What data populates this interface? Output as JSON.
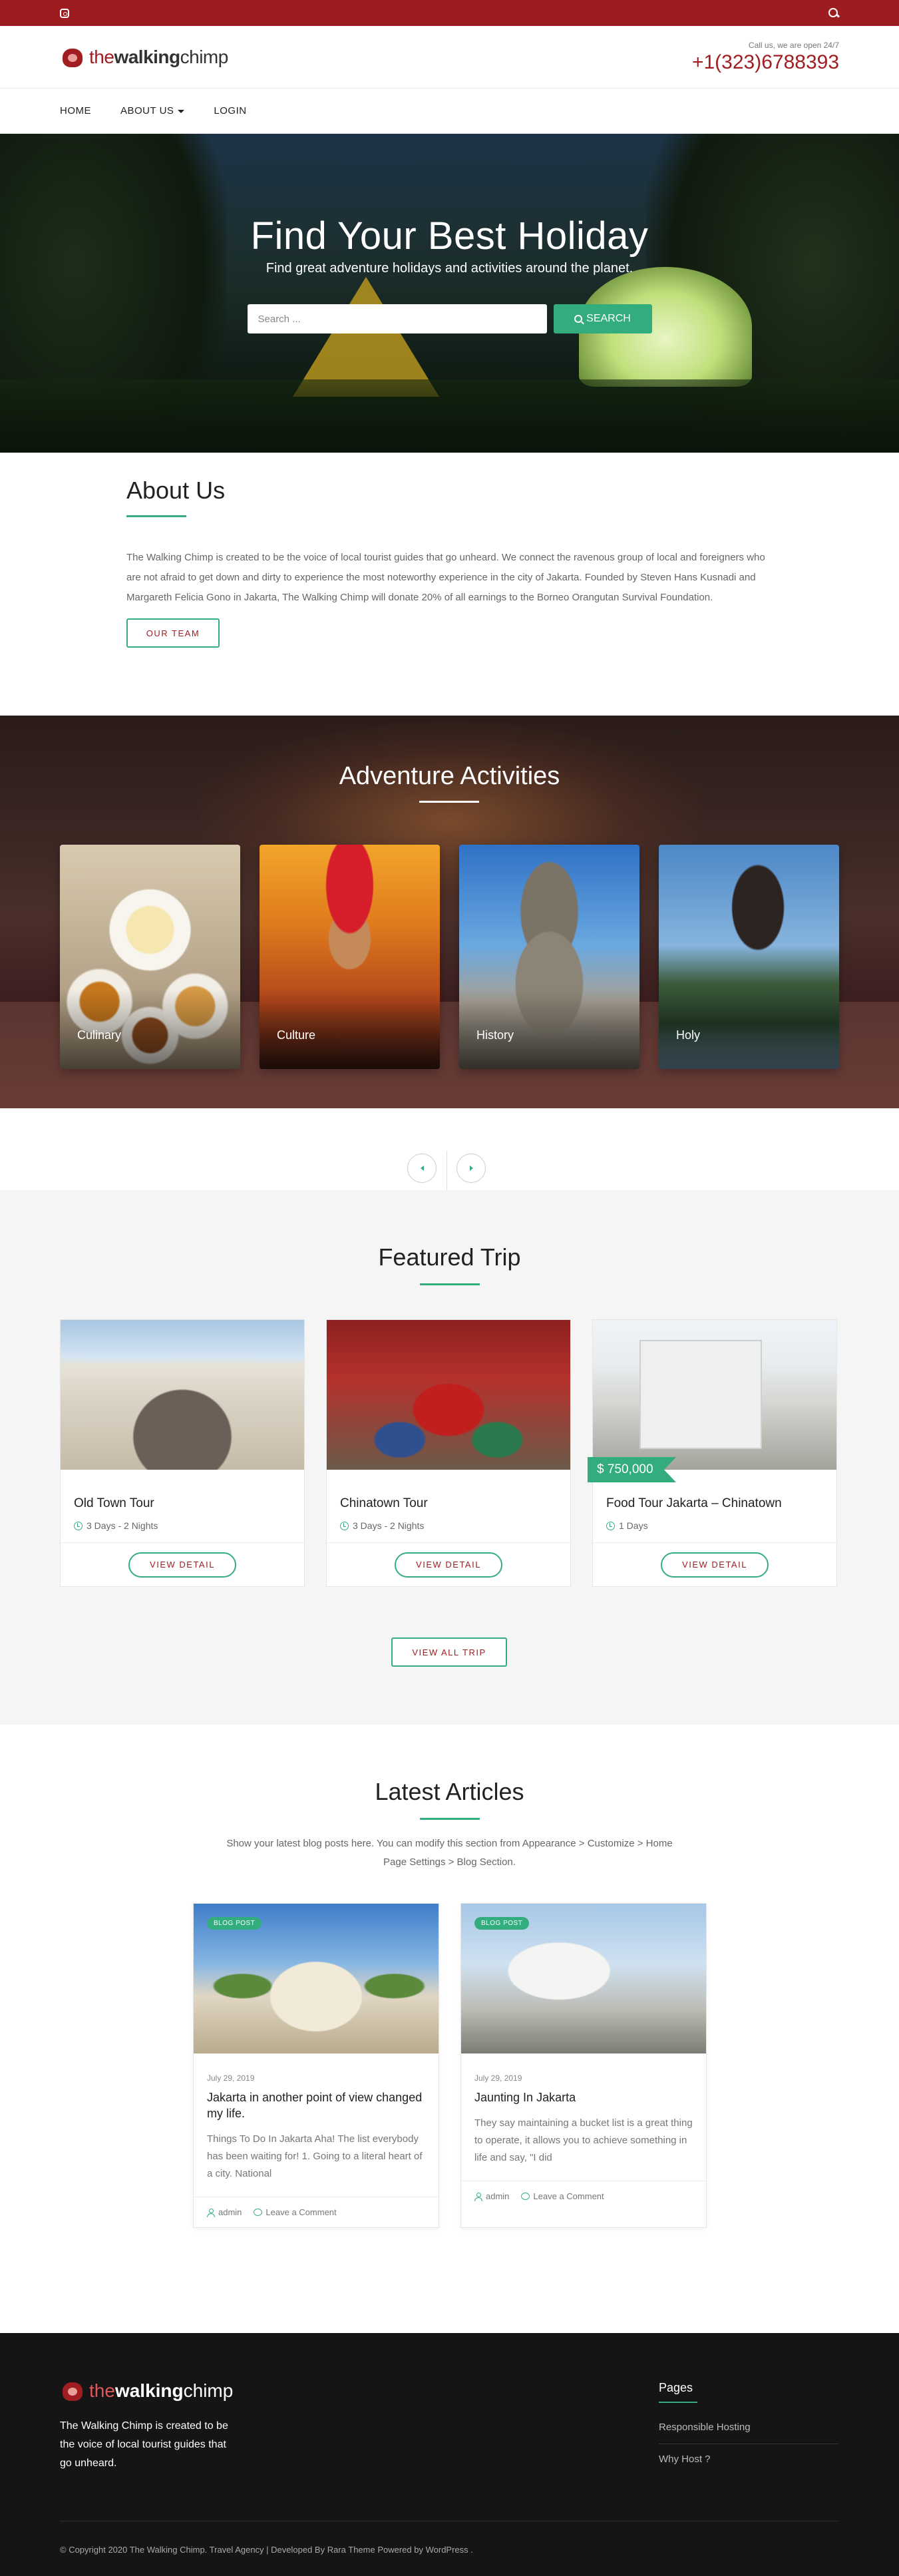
{
  "topbar": {
    "instagram_icon": "instagram-icon",
    "search_icon": "search-icon",
    "bg_color": "#9c1c20"
  },
  "brand": {
    "logo_part1": "the",
    "logo_part2": "walking",
    "logo_part3": "chimp",
    "call_text": "Call us, we are open 24/7",
    "phone": "+1(323)6788393"
  },
  "nav": {
    "items": [
      "HOME",
      "ABOUT US",
      "LOGIN"
    ]
  },
  "hero": {
    "title": "Find Your Best Holiday",
    "subtitle": "Find great adventure holidays and activities around the planet.",
    "search_placeholder": "Search ...",
    "search_button": "SEARCH"
  },
  "about": {
    "title": "About Us",
    "text": "The Walking Chimp is created to be the voice of local tourist guides that go unheard. We connect the ravenous group of local and foreigners who are not afraid to get down and dirty to experience the most noteworthy experience in the city of Jakarta. Founded by Steven Hans Kusnadi and Margareth Felicia Gono in Jakarta, The Walking Chimp will donate 20% of all earnings to the Borneo Orangutan Survival Foundation.",
    "button": "OUR TEAM"
  },
  "activities": {
    "title": "Adventure Activities",
    "items": [
      "Culinary",
      "Culture",
      "History",
      "Holy"
    ]
  },
  "trips": {
    "title": "Featured Trip",
    "items": [
      {
        "title": "Old Town Tour",
        "duration": "3 Days - 2 Nights",
        "button": "VIEW DETAIL",
        "price": ""
      },
      {
        "title": "Chinatown Tour",
        "duration": "3 Days - 2 Nights",
        "button": "VIEW DETAIL",
        "price": ""
      },
      {
        "title": "Food Tour Jakarta – Chinatown",
        "duration": "1 Days",
        "button": "VIEW DETAIL",
        "price": "$ 750,000"
      }
    ],
    "view_all": "VIEW ALL TRIP"
  },
  "articles": {
    "title": "Latest Articles",
    "intro": "Show your latest blog posts here. You can modify this section from Appearance > Customize > Home Page Settings > Blog Section.",
    "items": [
      {
        "badge": "BLOG POST",
        "date": "July 29, 2019",
        "title": "Jakarta in another point of view changed my life.",
        "excerpt": "Things To Do In Jakarta Aha! The list everybody has been waiting for! 1. Going to a literal heart of a city. National",
        "author": "admin",
        "comment": "Leave a Comment"
      },
      {
        "badge": "BLOG POST",
        "date": "July 29, 2019",
        "title": "Jaunting In Jakarta",
        "excerpt": "They say maintaining a bucket list is a great thing to operate, it allows you to achieve something in life and say, \"I did",
        "author": "admin",
        "comment": "Leave a Comment"
      }
    ]
  },
  "footer": {
    "logo_part1": "the",
    "logo_part2": "walking",
    "logo_part3": "chimp",
    "description": "The Walking Chimp is created to be the voice of local tourist guides that go unheard.",
    "pages_title": "Pages",
    "pages_links": [
      "Responsible Hosting",
      "Why Host ?"
    ],
    "copyright": "© Copyright 2020 The Walking Chimp. Travel Agency | Developed By Rara Theme Powered by WordPress ."
  },
  "colors": {
    "accent": "#34ad7e",
    "brand_red": "#a01d22",
    "footer_bg": "#151516"
  }
}
